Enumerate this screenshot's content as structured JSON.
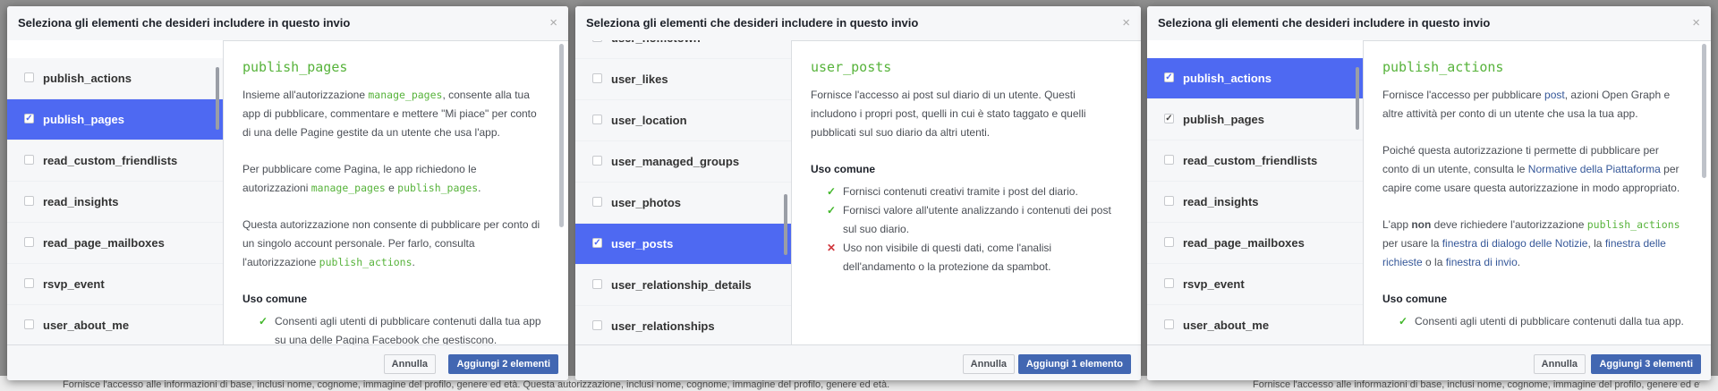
{
  "background_text": {
    "left": "Fornisce l'accesso alle informazioni di base, inclusi nome, cognome, immagine del profilo, genere ed età. Questa autorizzazione, inclusi nome, cognome, immagine del profilo, genere ed età.",
    "right": "Fornisce l'accesso alle informazioni di base, inclusi nome, cognome, immagine del profilo, genere ed età."
  },
  "colors": {
    "selected_row": "#4e69f2",
    "accent_green": "#57b33b",
    "primary_button": "#4267b2"
  },
  "dialogs": [
    {
      "title": "Seleziona gli elementi che desideri includere in questo invio",
      "close": "×",
      "list": [
        {
          "label": "publish_actions",
          "checked": false,
          "selected": false
        },
        {
          "label": "publish_pages",
          "checked": true,
          "selected": true
        },
        {
          "label": "read_custom_friendlists",
          "checked": false,
          "selected": false
        },
        {
          "label": "read_insights",
          "checked": false,
          "selected": false
        },
        {
          "label": "read_page_mailboxes",
          "checked": false,
          "selected": false
        },
        {
          "label": "rsvp_event",
          "checked": false,
          "selected": false
        },
        {
          "label": "user_about_me",
          "checked": false,
          "selected": false
        }
      ],
      "detail": {
        "title": "publish_pages",
        "p1": {
          "a": "Insieme all'autorizzazione ",
          "code": "manage_pages",
          "b": ", consente alla tua app di pubblicare, commentare e mettere \"Mi piace\" per conto di una delle Pagine gestite da un utente che usa l'app."
        },
        "p2": {
          "a": "Per pubblicare come Pagina, le app richiedono le autorizzazioni ",
          "code1": "manage_pages",
          "b": " e ",
          "code2": "publish_pages",
          "c": "."
        },
        "p3": {
          "a": "Questa autorizzazione non consente di pubblicare per conto di un singolo account personale. Per farlo, consulta l'autorizzazione ",
          "code": "publish_actions",
          "b": "."
        },
        "uso_title": "Uso comune",
        "uso": [
          {
            "icon": "check",
            "text": "Consenti agli utenti di pubblicare contenuti dalla tua app su una delle Pagina Facebook che gestiscono."
          }
        ]
      },
      "footer": {
        "cancel": "Annulla",
        "add": "Aggiungi 2 elementi"
      }
    },
    {
      "title": "Seleziona gli elementi che desideri includere in questo invio",
      "close": "×",
      "list": [
        {
          "label": "user_hometown",
          "checked": false,
          "selected": false
        },
        {
          "label": "user_likes",
          "checked": false,
          "selected": false
        },
        {
          "label": "user_location",
          "checked": false,
          "selected": false
        },
        {
          "label": "user_managed_groups",
          "checked": false,
          "selected": false
        },
        {
          "label": "user_photos",
          "checked": false,
          "selected": false
        },
        {
          "label": "user_posts",
          "checked": true,
          "selected": true
        },
        {
          "label": "user_relationship_details",
          "checked": false,
          "selected": false
        },
        {
          "label": "user_relationships",
          "checked": false,
          "selected": false
        }
      ],
      "detail": {
        "title": "user_posts",
        "p1": "Fornisce l'accesso ai post sul diario di un utente. Questi includono i propri post, quelli in cui è stato taggato e quelli pubblicati sul suo diario da altri utenti.",
        "uso_title": "Uso comune",
        "uso": [
          {
            "icon": "check",
            "text": "Fornisci contenuti creativi tramite i post del diario."
          },
          {
            "icon": "check",
            "text": "Fornisci valore all'utente analizzando i contenuti dei post sul suo diario."
          },
          {
            "icon": "cross",
            "text": "Uso non visibile di questi dati, come l'analisi dell'andamento o la protezione da spambot."
          }
        ]
      },
      "footer": {
        "cancel": "Annulla",
        "add": "Aggiungi 1 elemento"
      }
    },
    {
      "title": "Seleziona gli elementi che desideri includere in questo invio",
      "close": "×",
      "list": [
        {
          "label": "publish_actions",
          "checked": true,
          "selected": true
        },
        {
          "label": "publish_pages",
          "checked": true,
          "selected": false
        },
        {
          "label": "read_custom_friendlists",
          "checked": false,
          "selected": false
        },
        {
          "label": "read_insights",
          "checked": false,
          "selected": false
        },
        {
          "label": "read_page_mailboxes",
          "checked": false,
          "selected": false
        },
        {
          "label": "rsvp_event",
          "checked": false,
          "selected": false
        },
        {
          "label": "user_about_me",
          "checked": false,
          "selected": false
        }
      ],
      "detail": {
        "title": "publish_actions",
        "p1": {
          "a": "Fornisce l'accesso per pubblicare ",
          "link": "post",
          "b": ", azioni Open Graph e altre attività per conto di un utente che usa la tua app."
        },
        "p2": {
          "a": "Poiché questa autorizzazione ti permette di pubblicare per conto di un utente, consulta le ",
          "link": "Normative della Piattaforma",
          "b": " per capire come usare questa autorizzazione in modo appropriato."
        },
        "p3": {
          "a": "L'app ",
          "strong": "non",
          "b": " deve richiedere l'autorizzazione ",
          "code": "publish_actions",
          "c": " per usare la ",
          "link1": "finestra di dialogo delle Notizie",
          "d": ", la ",
          "link2": "finestra delle richieste",
          "e": " o la ",
          "link3": "finestra di invio",
          "f": "."
        },
        "uso_title": "Uso comune",
        "uso": [
          {
            "icon": "check",
            "text": "Consenti agli utenti di pubblicare contenuti dalla tua app."
          }
        ]
      },
      "footer": {
        "cancel": "Annulla",
        "add": "Aggiungi 3 elementi"
      }
    }
  ]
}
